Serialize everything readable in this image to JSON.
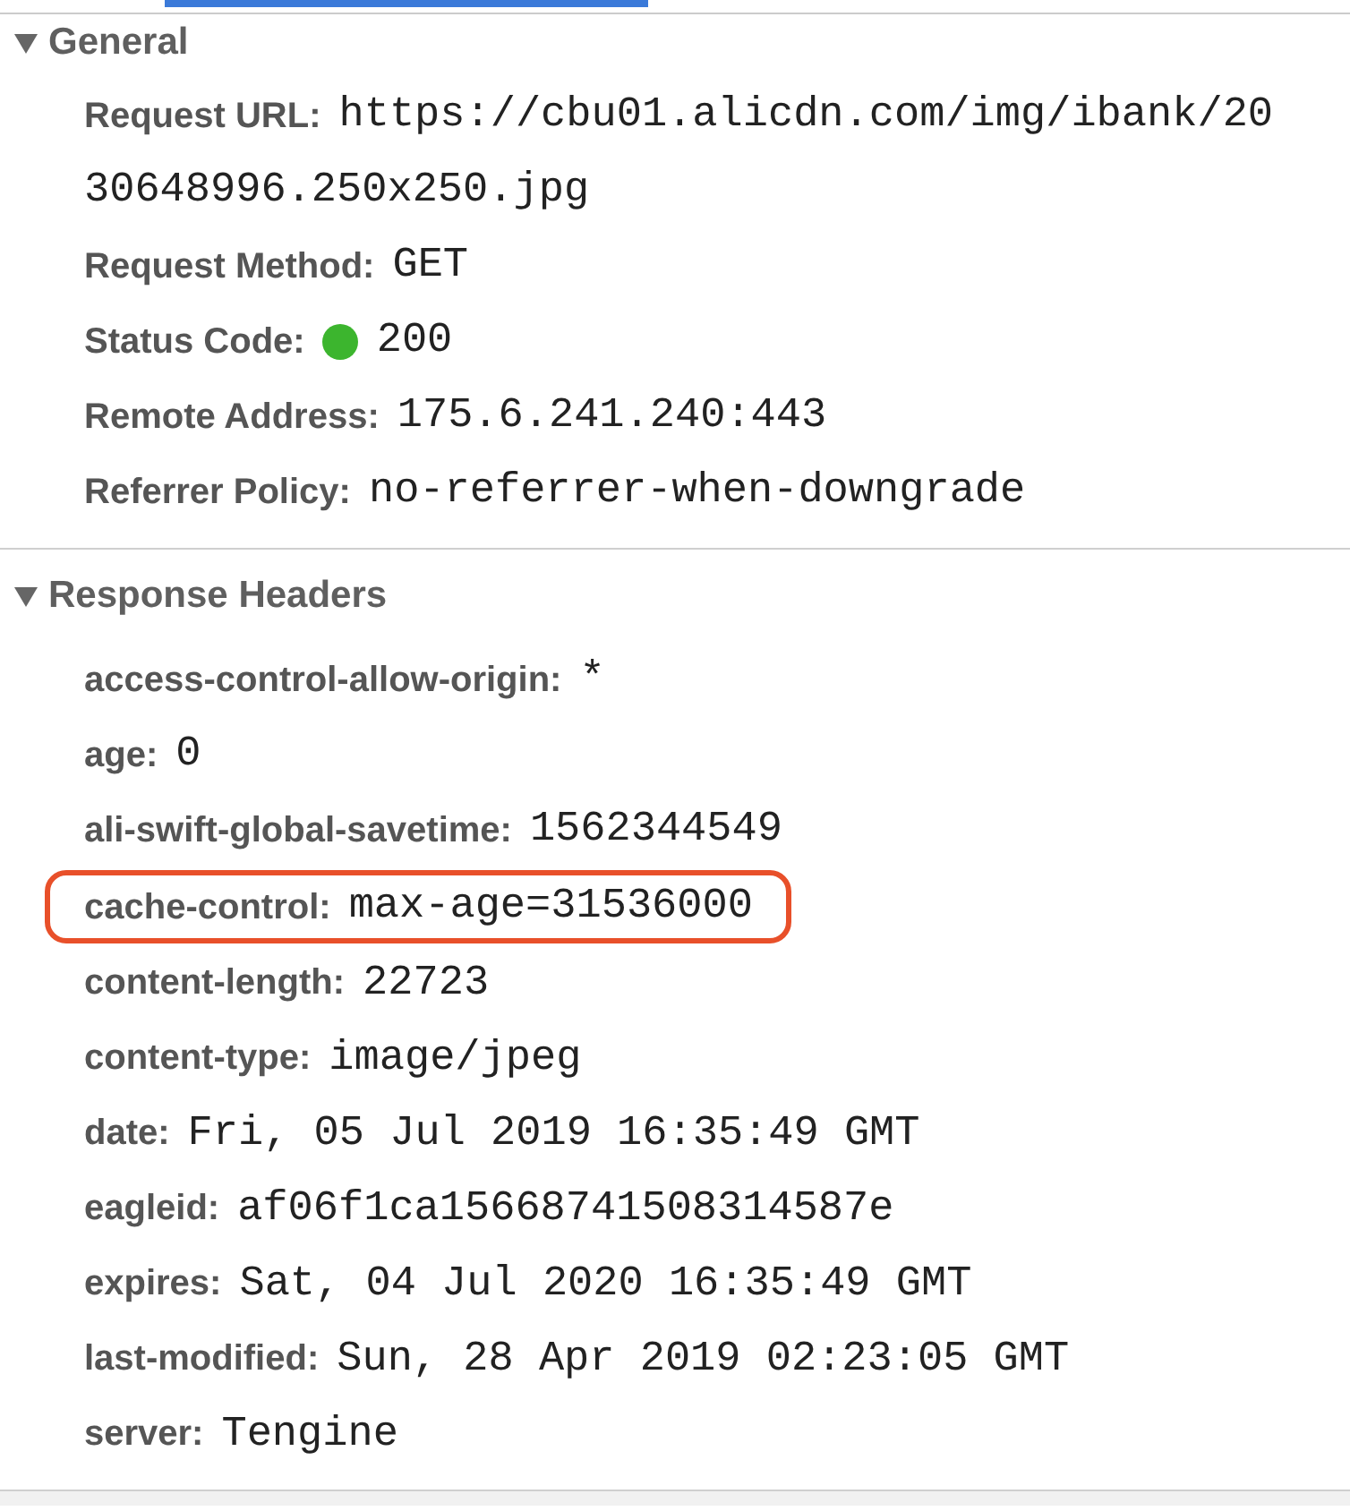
{
  "tab_strip": {
    "tabs": [
      {
        "selected": true
      }
    ]
  },
  "sections": [
    {
      "title": "General",
      "expanded": true,
      "rows": [
        {
          "name": "Request URL:",
          "value_lines": [
            "https://cbu01.alicdn.com/img/ibank/20",
            "30648996.250x250.jpg"
          ]
        },
        {
          "name": "Request Method:",
          "value_lines": [
            "GET"
          ]
        },
        {
          "name": "Status Code:",
          "color": "#3cb52e",
          "value_lines": [
            "200"
          ]
        },
        {
          "name": "Remote Address:",
          "value_lines": [
            "175.6.241.240:443"
          ]
        },
        {
          "name": "Referrer Policy:",
          "value_lines": [
            "no-referrer-when-downgrade"
          ]
        }
      ]
    },
    {
      "title": "Response Headers",
      "expanded": true,
      "rows": [
        {
          "name": "access-control-allow-origin:",
          "value_lines": [
            "*"
          ]
        },
        {
          "name": "age:",
          "value_lines": [
            "0"
          ]
        },
        {
          "name": "ali-swift-global-savetime:",
          "value_lines": [
            "1562344549"
          ]
        },
        {
          "name": "cache-control:",
          "value_lines": [
            "max-age=31536000"
          ],
          "highlighted": true
        },
        {
          "name": "content-length:",
          "value_lines": [
            "22723"
          ]
        },
        {
          "name": "content-type:",
          "value_lines": [
            "image/jpeg"
          ]
        },
        {
          "name": "date:",
          "value_lines": [
            "Fri, 05 Jul 2019 16:35:49 GMT"
          ]
        },
        {
          "name": "eagleid:",
          "value_lines": [
            "af06f1ca15668741508314587e"
          ]
        },
        {
          "name": "expires:",
          "value_lines": [
            "Sat, 04 Jul 2020 16:35:49 GMT"
          ]
        },
        {
          "name": "last-modified:",
          "value_lines": [
            "Sun, 28 Apr 2019 02:23:05 GMT"
          ]
        },
        {
          "name": "server:",
          "value_lines": [
            "Tengine"
          ]
        }
      ]
    }
  ]
}
